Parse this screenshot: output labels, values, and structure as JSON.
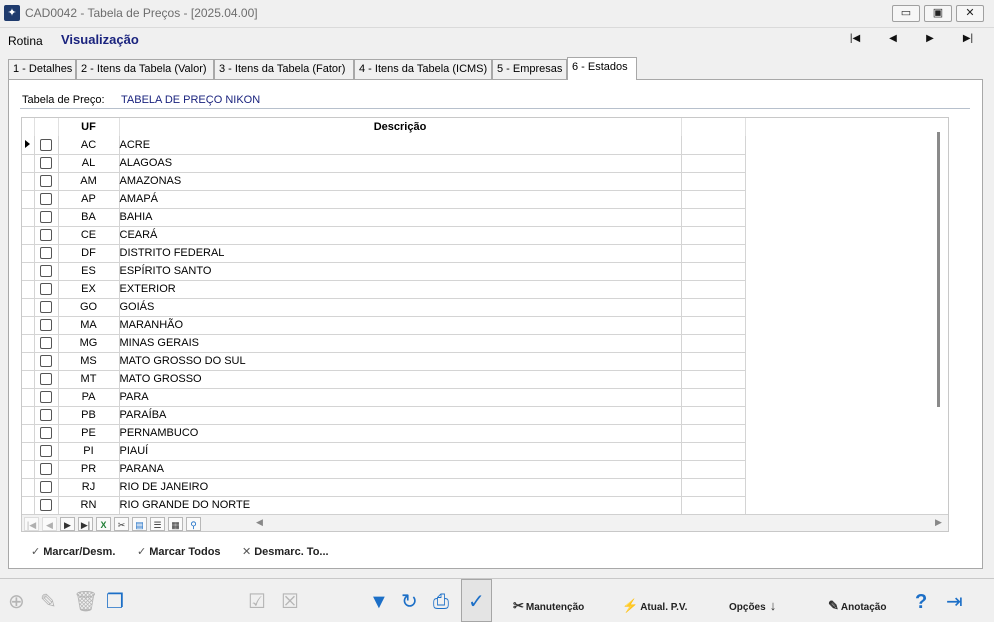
{
  "window": {
    "title": "CAD0042 - Tabela de Preços - [2025.04.00]",
    "buttons": {
      "minimize": "▭",
      "restore": "▣",
      "close": "✕"
    }
  },
  "menu": {
    "rotina": "Rotina",
    "mode": "Visualização",
    "nav": {
      "first": "|◀",
      "prev": "◀",
      "next": "▶",
      "last": "▶|"
    }
  },
  "tabs": [
    {
      "label": "1 - Detalhes"
    },
    {
      "label": "2 - Itens da Tabela (Valor)"
    },
    {
      "label": "3 - Itens da Tabela (Fator)"
    },
    {
      "label": "4 - Itens da Tabela (ICMS)"
    },
    {
      "label": "5 - Empresas"
    },
    {
      "label": "6 - Estados",
      "active": true
    }
  ],
  "header": {
    "label": "Tabela de Preço:",
    "value": "TABELA DE PREÇO NIKON"
  },
  "grid": {
    "columns": {
      "uf": "UF",
      "descricao": "Descrição"
    },
    "rows": [
      {
        "uf": "AC",
        "desc": "ACRE",
        "checked": false,
        "current": true
      },
      {
        "uf": "AL",
        "desc": "ALAGOAS",
        "checked": false
      },
      {
        "uf": "AM",
        "desc": "AMAZONAS",
        "checked": false
      },
      {
        "uf": "AP",
        "desc": "AMAPÁ",
        "checked": false
      },
      {
        "uf": "BA",
        "desc": "BAHIA",
        "checked": false
      },
      {
        "uf": "CE",
        "desc": "CEARÁ",
        "checked": false
      },
      {
        "uf": "DF",
        "desc": "DISTRITO FEDERAL",
        "checked": false
      },
      {
        "uf": "ES",
        "desc": "ESPÍRITO SANTO",
        "checked": false
      },
      {
        "uf": "EX",
        "desc": "EXTERIOR",
        "checked": false
      },
      {
        "uf": "GO",
        "desc": "GOIÁS",
        "checked": false
      },
      {
        "uf": "MA",
        "desc": "MARANHÃO",
        "checked": false
      },
      {
        "uf": "MG",
        "desc": "MINAS GERAIS",
        "checked": false
      },
      {
        "uf": "MS",
        "desc": "MATO GROSSO DO SUL",
        "checked": false
      },
      {
        "uf": "MT",
        "desc": "MATO GROSSO",
        "checked": false
      },
      {
        "uf": "PA",
        "desc": "PARA",
        "checked": false
      },
      {
        "uf": "PB",
        "desc": "PARAÍBA",
        "checked": false
      },
      {
        "uf": "PE",
        "desc": "PERNAMBUCO",
        "checked": false
      },
      {
        "uf": "PI",
        "desc": "PIAUÍ",
        "checked": false
      },
      {
        "uf": "PR",
        "desc": "PARANA",
        "checked": false
      },
      {
        "uf": "RJ",
        "desc": "RIO DE JANEIRO",
        "checked": false
      },
      {
        "uf": "RN",
        "desc": "RIO GRANDE DO NORTE",
        "checked": false
      }
    ]
  },
  "grid_toolbar": {
    "icons": [
      "first-icon",
      "prev-icon",
      "next-icon",
      "last-icon",
      "excel-icon",
      "tools-icon",
      "save-icon",
      "columns-icon",
      "print-preview-icon",
      "search-icon"
    ]
  },
  "links": {
    "marcar": "Marcar/Desm.",
    "marcar_todos": "Marcar Todos",
    "desmarcar": "Desmarc. To..."
  },
  "toolbar": {
    "manutencao": "Manutenção",
    "atual_pv": "Atual. P.V.",
    "opcoes": "Opções",
    "anotacao": "Anotação"
  },
  "colors": {
    "accent": "#1c6fc7",
    "title_blue": "#1a237e"
  }
}
